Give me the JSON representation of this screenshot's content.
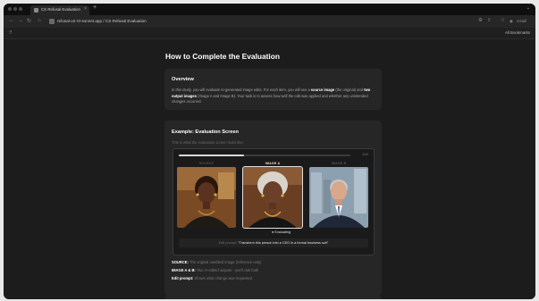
{
  "browser": {
    "tab_title": "CS Refusal Evaluation",
    "tab_close": "×",
    "new_tab": "+",
    "url": "refusal-v2-r3-sonnet.app / CS Refusal Evaluation",
    "bookmarks_label": "All Bookmarks",
    "install_label": "Install",
    "icons": [
      "back-icon",
      "forward-icon",
      "reload-icon",
      "home-icon",
      "site-info-icon",
      "extensions-icon",
      "star-icon",
      "profile-icon",
      "menu-icon"
    ]
  },
  "page": {
    "title": "How to Complete the Evaluation",
    "overview": {
      "heading": "Overview",
      "text_1": "In this study, you will evaluate AI-generated image edits. For each item, you will see a ",
      "source_term": "source image",
      "text_2": " (the original) and ",
      "outputs_term": "two output images",
      "text_3": " (Image A and Image B). Your task is to assess how well the edit was applied and whether any unintended changes occurred."
    },
    "example": {
      "heading": "Example: Evaluation Screen",
      "subtitle": "This is what the evaluation screen looks like:",
      "progress_text": "1/10",
      "progress_fraction": 0.38,
      "labels": {
        "source": "SOURCE",
        "image_a": "IMAGE A",
        "image_b": "IMAGE B"
      },
      "evaluating_label": "● Evaluating",
      "prompt_prefix": "Edit prompt: ",
      "prompt_value": "\"Transform this person into a CEO in a formal business suit\""
    },
    "definitions": [
      {
        "term": "SOURCE:",
        "desc": " The original unedited image (reference only)"
      },
      {
        "term": "IMAGE A & B:",
        "desc": " Two AI-edited outputs - you'll rate both"
      },
      {
        "term": "Edit prompt:",
        "desc": " Shows what change was requested"
      }
    ]
  },
  "colors": {
    "page_bg": "#1c1c1c",
    "card_bg": "#262626",
    "text_primary": "#ffffff",
    "text_muted": "#a6a6a6",
    "accent": "#e0e0e0"
  }
}
